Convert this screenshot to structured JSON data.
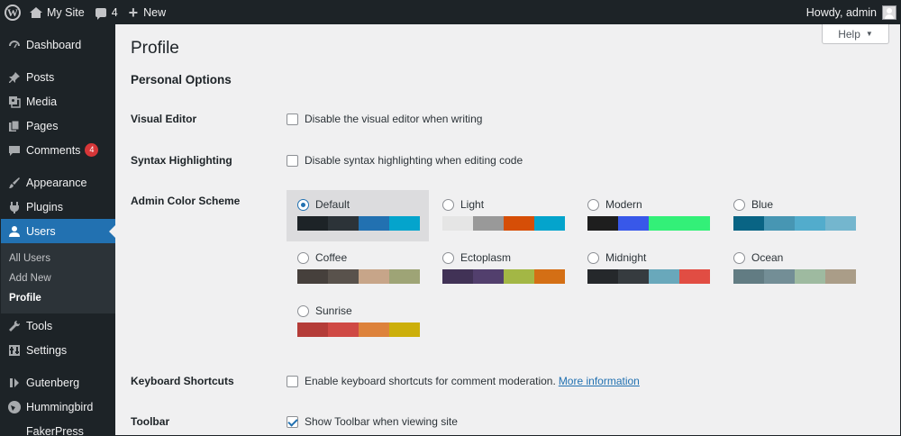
{
  "adminbar": {
    "site_name": "My Site",
    "comments_count": "4",
    "new_label": "New",
    "howdy": "Howdy, admin"
  },
  "sidebar": {
    "items": [
      {
        "label": "Dashboard",
        "icon": "dashboard-icon"
      },
      {
        "label": "Posts",
        "icon": "pin-icon"
      },
      {
        "label": "Media",
        "icon": "media-icon"
      },
      {
        "label": "Pages",
        "icon": "pages-icon"
      },
      {
        "label": "Comments",
        "icon": "comment-icon",
        "badge": "4"
      },
      {
        "label": "Appearance",
        "icon": "brush-icon"
      },
      {
        "label": "Plugins",
        "icon": "plug-icon"
      },
      {
        "label": "Users",
        "icon": "user-icon"
      },
      {
        "label": "Tools",
        "icon": "wrench-icon"
      },
      {
        "label": "Settings",
        "icon": "settings-icon"
      },
      {
        "label": "Gutenberg",
        "icon": "gutenberg-icon"
      },
      {
        "label": "Hummingbird",
        "icon": "hummingbird-icon"
      },
      {
        "label": "FakerPress",
        "icon": ""
      }
    ],
    "submenu": [
      "All Users",
      "Add New",
      "Profile"
    ]
  },
  "main": {
    "help_label": "Help",
    "title": "Profile",
    "section": "Personal Options",
    "visual_editor": {
      "label": "Visual Editor",
      "option": "Disable the visual editor when writing",
      "checked": false
    },
    "syntax": {
      "label": "Syntax Highlighting",
      "option": "Disable syntax highlighting when editing code",
      "checked": false
    },
    "color_scheme_label": "Admin Color Scheme",
    "schemes": [
      {
        "name": "Default",
        "colors": [
          "#1d2327",
          "#2c3338",
          "#2271b1",
          "#72aee6"
        ],
        "selected": true
      },
      {
        "name": "Light",
        "colors": [
          "#e5e5e5",
          "#999999",
          "#d64e07",
          "#04a4cc"
        ],
        "selected": false
      },
      {
        "name": "Modern",
        "colors": [
          "#1e1e1e",
          "#3858e9",
          "#33f078",
          "#33f078"
        ],
        "selected": false
      },
      {
        "name": "Blue",
        "colors": [
          "#096484",
          "#4796b3",
          "#52accc",
          "#74b6ce"
        ],
        "selected": false
      },
      {
        "name": "Coffee",
        "colors": [
          "#46403c",
          "#59524c",
          "#c7a589",
          "#9ea476"
        ],
        "selected": false
      },
      {
        "name": "Ectoplasm",
        "colors": [
          "#413256",
          "#523f6d",
          "#a3b745",
          "#d46f15"
        ],
        "selected": false
      },
      {
        "name": "Midnight",
        "colors": [
          "#25282b",
          "#363b3f",
          "#69a8bb",
          "#e14d43"
        ],
        "selected": false
      },
      {
        "name": "Ocean",
        "colors": [
          "#627c83",
          "#738e96",
          "#9ebaa0",
          "#aa9d88"
        ],
        "selected": false
      },
      {
        "name": "Sunrise",
        "colors": [
          "#b43c38",
          "#cf4944",
          "#dd823b",
          "#ccaf0b"
        ],
        "selected": false
      }
    ],
    "keyboard": {
      "label": "Keyboard Shortcuts",
      "option": "Enable keyboard shortcuts for comment moderation.",
      "link": "More information",
      "checked": false
    },
    "toolbar": {
      "label": "Toolbar",
      "option": "Show Toolbar when viewing site",
      "checked": true
    }
  }
}
